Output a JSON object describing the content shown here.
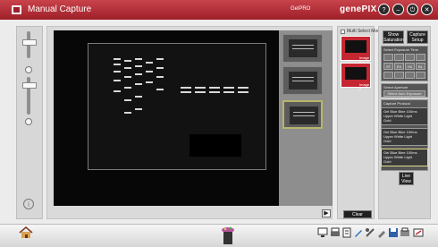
{
  "titlebar": {
    "title": "Manual Capture",
    "brand_small": "GelPRO",
    "brand": "genePIX",
    "buttons": [
      {
        "name": "help-button",
        "glyph": "?"
      },
      {
        "name": "minimize-button",
        "glyph": "–"
      },
      {
        "name": "power-button",
        "glyph": "⏻"
      },
      {
        "name": "close-button",
        "glyph": "✕"
      }
    ]
  },
  "left_panel": {
    "info_glyph": "i"
  },
  "multi_select": {
    "label": "Multi Select Mode",
    "thumbnails": [
      {
        "caption": "Image 1"
      },
      {
        "caption": "Image 2"
      }
    ],
    "clear_label": "Clear"
  },
  "viewer": {
    "expand_glyph": "▶"
  },
  "right_panel": {
    "show_saturation": "Show Saturation",
    "capture_setup": "Capture Setup",
    "filter_group_title": "Select Exposure Time",
    "filter_buttons_row1": [
      "ST",
      "EX",
      "HX",
      "BL"
    ],
    "aperture_group_title": "Select Aperture",
    "aperture_button": "Select Auto Exposure Area",
    "capture_protocol_title": "Capture Protocol",
    "conditions": [
      {
        "line1": "Gel Blue Bine 100ms",
        "line2": "Upper White Light",
        "line3": "Gold"
      },
      {
        "line1": "Gel Blue Bine 100ms",
        "line2": "Upper White Light",
        "line3": "Gold"
      },
      {
        "line1": "Gel Blue Bine 100ms",
        "line2": "Upper White Light",
        "line3": "Gold"
      }
    ],
    "live_view": "Live View"
  },
  "colors": {
    "title_red": "#9e1f29",
    "selection_yellow": "#b8b46a"
  }
}
